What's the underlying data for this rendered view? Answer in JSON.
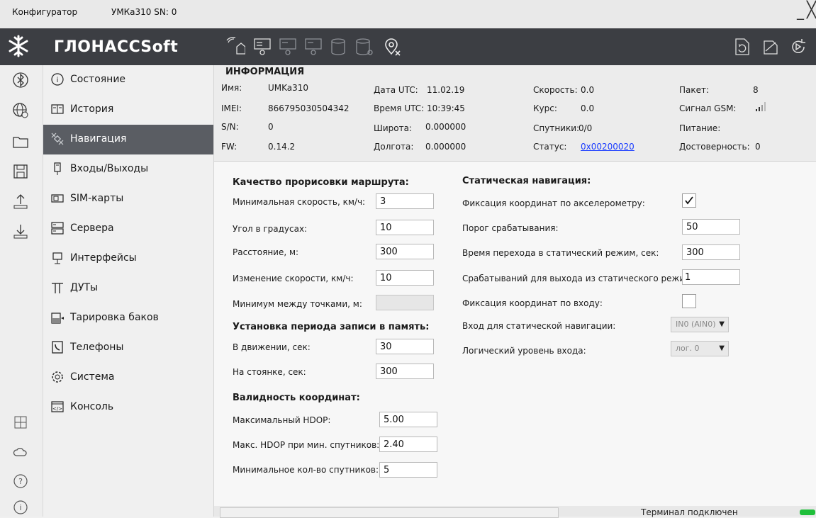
{
  "titlebar": {
    "app": "Конфигуратор",
    "device": "УМКа310 SN: 0",
    "min": "_",
    "close": "╳"
  },
  "header": {
    "logo": "ГЛОНАССSoft"
  },
  "nav": [
    {
      "label": "Состояние",
      "icon": "info-circle-icon"
    },
    {
      "label": "История",
      "icon": "book-icon"
    },
    {
      "label": "Навигация",
      "icon": "satellite-icon",
      "active": true
    },
    {
      "label": "Входы/Выходы",
      "icon": "plug-icon"
    },
    {
      "label": "SIM-карты",
      "icon": "sim-card-icon"
    },
    {
      "label": "Сервера",
      "icon": "server-icon"
    },
    {
      "label": "Интерфейсы",
      "icon": "connector-icon"
    },
    {
      "label": "ДУТы",
      "icon": "fuel-sensor-icon"
    },
    {
      "label": "Тарировка баков",
      "icon": "tank-icon"
    },
    {
      "label": "Телефоны",
      "icon": "phone-icon"
    },
    {
      "label": "Система",
      "icon": "gear-icon"
    },
    {
      "label": "Консоль",
      "icon": "console-icon"
    }
  ],
  "info": {
    "title": "ИНФОРМАЦИЯ",
    "name_label": "Имя:",
    "name": "UMKa310",
    "imei_label": "IMEI:",
    "imei": "866795030504342",
    "sn_label": "S/N:",
    "sn": "0",
    "fw_label": "FW:",
    "fw": "0.14.2",
    "date_label": "Дата UTC:",
    "date": "11.02.19",
    "time_label": "Время UTC:",
    "time": "10:39:45",
    "lat_label": "Широта:",
    "lat": "0.000000",
    "lon_label": "Долгота:",
    "lon": "0.000000",
    "speed_label": "Скорость:",
    "speed": "0.0",
    "course_label": "Курс:",
    "course": "0.0",
    "sats_label": "Спутники:",
    "sats": "0/0",
    "status_label": "Статус:",
    "status": "0x00200020",
    "packet_label": "Пакет:",
    "packet": "8",
    "gsm_label": "Сигнал GSM:",
    "power_label": "Питание:",
    "valid_label": "Достоверность:",
    "valid": "0"
  },
  "route": {
    "title": "Качество прорисовки маршрута:",
    "min_speed_label": "Минимальная скорость, км/ч:",
    "min_speed": "3",
    "angle_label": "Угол в градусах:",
    "angle": "10",
    "distance_label": "Расстояние, м:",
    "distance": "300",
    "speed_change_label": "Изменение скорости, км/ч:",
    "speed_change": "10",
    "min_between_label": "Минимум между точками, м:",
    "min_between": ""
  },
  "period": {
    "title": "Установка периода записи в память:",
    "moving_label": "В движении, сек:",
    "moving": "30",
    "parking_label": "На стоянке, сек:",
    "parking": "300"
  },
  "validity": {
    "title": "Валидность координат:",
    "hdop_label": "Максимальный HDOP:",
    "hdop": "5.00",
    "hdop_min_label": "Макс. HDOP при мин. спутников:",
    "hdop_min": "2.40",
    "min_sats_label": "Минимальное кол-во спутников:",
    "min_sats": "5"
  },
  "static": {
    "title": "Статическая навигация:",
    "accel_label": "Фиксация координат по акселерометру:",
    "accel_checked": true,
    "threshold_label": "Порог срабатывания:",
    "threshold": "50",
    "transition_label": "Время перехода в статический режим, сек:",
    "transition": "300",
    "exit_label": "Срабатываний для выхода из статического режима:",
    "exit": "1",
    "input_fix_label": "Фиксация координат по входу:",
    "input_fix_checked": false,
    "input_label": "Вход для статической навигации:",
    "input": "IN0 (AIN0)",
    "level_label": "Логический уровень входа:",
    "level": "лог. 0"
  },
  "statusbar": {
    "text": "Терминал подключен"
  },
  "colors": {
    "header": "#3c3e43",
    "nav_active": "#5a5d63",
    "link": "#1a3cff",
    "led": "#1fbf3a"
  }
}
